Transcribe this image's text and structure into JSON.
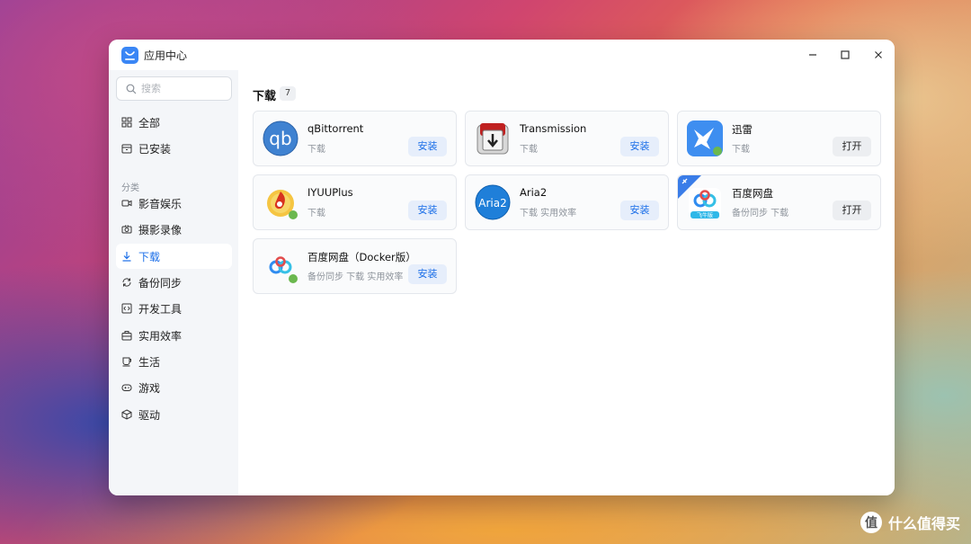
{
  "window": {
    "title": "应用中心"
  },
  "controls": {
    "minimize": "–",
    "maximize": "☐",
    "close": "✕"
  },
  "sidebar": {
    "search_placeholder": "搜索",
    "top_items": [
      {
        "label": "全部",
        "icon": "grid-icon"
      },
      {
        "label": "已安装",
        "icon": "installed-box-icon"
      }
    ],
    "section_label": "分类",
    "categories": [
      {
        "label": "影音娱乐",
        "icon": "video-icon"
      },
      {
        "label": "摄影录像",
        "icon": "camera-icon"
      },
      {
        "label": "下载",
        "icon": "download-icon",
        "active": true
      },
      {
        "label": "备份同步",
        "icon": "sync-icon"
      },
      {
        "label": "开发工具",
        "icon": "code-icon"
      },
      {
        "label": "实用效率",
        "icon": "toolbox-icon"
      },
      {
        "label": "生活",
        "icon": "cup-icon"
      },
      {
        "label": "游戏",
        "icon": "gamepad-icon"
      },
      {
        "label": "驱动",
        "icon": "cube-icon"
      }
    ]
  },
  "main": {
    "heading": "下载",
    "count": "7",
    "apps": [
      {
        "name": "qBittorrent",
        "tags": "下载",
        "action": "安装"
      },
      {
        "name": "Transmission",
        "tags": "下载",
        "action": "安装"
      },
      {
        "name": "迅雷",
        "tags": "下载",
        "action": "打开"
      },
      {
        "name": "IYUUPlus",
        "tags": "下载",
        "action": "安装"
      },
      {
        "name": "Aria2",
        "tags": "下载 实用效率",
        "action": "安装"
      },
      {
        "name": "百度网盘",
        "tags": "备份同步 下载",
        "action": "打开"
      },
      {
        "name": "百度网盘（Docker版）",
        "tags": "备份同步 下载 实用效率",
        "action": "安装"
      }
    ],
    "aria2_logo_text": "Aria2",
    "qb_logo_text": "qb",
    "baidu_badge_text": "飞牛版"
  },
  "watermark": {
    "text": "什么值得买",
    "icon_text": "值"
  },
  "colors": {
    "accent": "#1a6ee8",
    "sidebar_bg": "#f4f6f9"
  }
}
